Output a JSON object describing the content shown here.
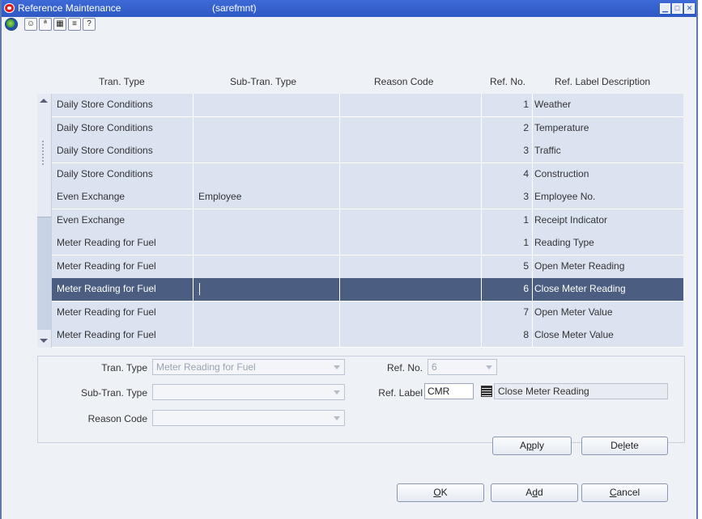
{
  "titlebar": {
    "title": "Reference Maintenance",
    "code": "(sarefmnt)"
  },
  "grid": {
    "columns": [
      "Tran. Type",
      "Sub-Tran. Type",
      "Reason Code",
      "Ref. No.",
      "Ref. Label Description"
    ],
    "rows": [
      [
        "Daily Store Conditions",
        "",
        "",
        "1",
        "Weather"
      ],
      [
        "Daily Store Conditions",
        "",
        "",
        "2",
        "Temperature"
      ],
      [
        "Daily Store Conditions",
        "",
        "",
        "3",
        "Traffic"
      ],
      [
        "Daily Store Conditions",
        "",
        "",
        "4",
        "Construction"
      ],
      [
        "Even Exchange",
        "Employee",
        "",
        "3",
        "Employee No."
      ],
      [
        "Even Exchange",
        "",
        "",
        "1",
        "Receipt Indicator"
      ],
      [
        "Meter Reading for Fuel",
        "",
        "",
        "1",
        "Reading Type"
      ],
      [
        "Meter Reading for Fuel",
        "",
        "",
        "5",
        "Open Meter Reading"
      ],
      [
        "Meter Reading for Fuel",
        "",
        "",
        "6",
        "Close Meter Reading"
      ],
      [
        "Meter Reading for Fuel",
        "",
        "",
        "7",
        "Open Meter Value"
      ],
      [
        "Meter Reading for Fuel",
        "",
        "",
        "8",
        "Close Meter Value"
      ]
    ],
    "selected_index": 8
  },
  "form": {
    "tran_type_label": "Tran. Type",
    "tran_type_value": "Meter Reading for Fuel",
    "sub_tran_type_label": "Sub-Tran. Type",
    "sub_tran_type_value": "",
    "reason_code_label": "Reason Code",
    "reason_code_value": "",
    "ref_no_label": "Ref. No.",
    "ref_no_value": "6",
    "ref_label_label": "Ref. Label",
    "ref_label_value": "CMR",
    "ref_label_desc": "Close Meter Reading"
  },
  "buttons": {
    "apply": {
      "pre": "A",
      "u": "p",
      "post": "ply"
    },
    "delete": {
      "pre": "De",
      "u": "l",
      "post": "ete"
    },
    "ok": {
      "pre": "",
      "u": "O",
      "post": "K"
    },
    "add": {
      "pre": "A",
      "u": "d",
      "post": "d"
    },
    "cancel": {
      "pre": "",
      "u": "C",
      "post": "ancel"
    }
  },
  "toolbar_icons": [
    "globe-icon",
    "face-icon",
    "spell-check-icon",
    "table-icon",
    "notes-icon",
    "help-icon"
  ]
}
